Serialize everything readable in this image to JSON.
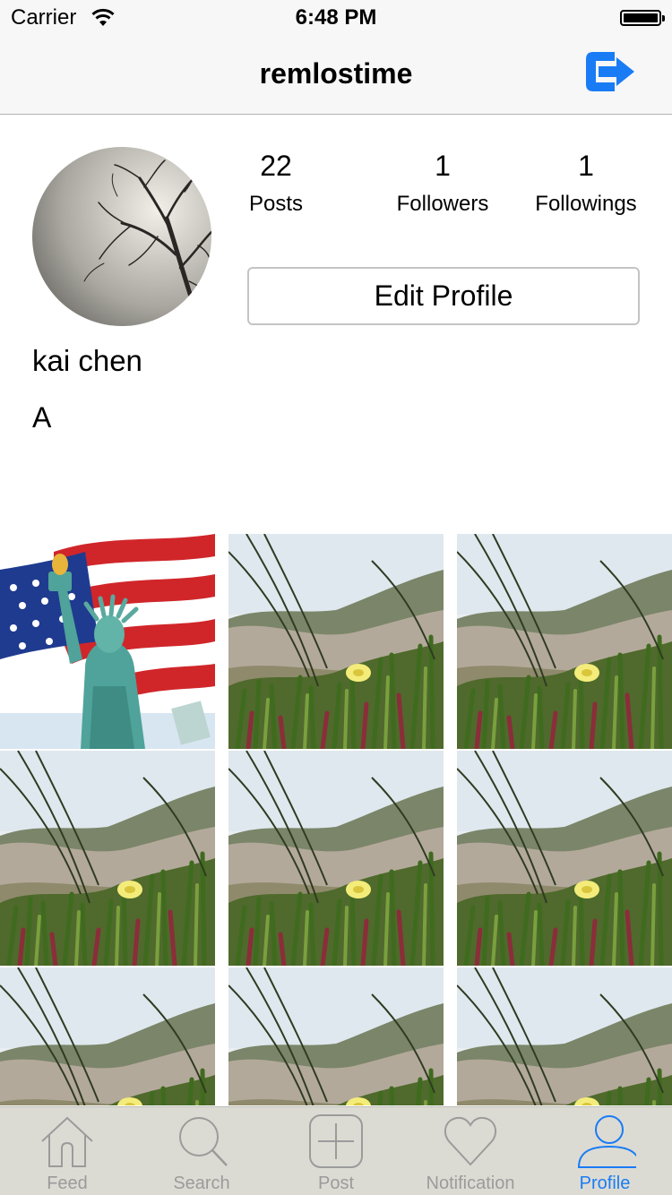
{
  "status_bar": {
    "carrier": "Carrier",
    "time": "6:48 PM"
  },
  "nav": {
    "title": "remlostime",
    "logout_icon": "logout-arrow-icon"
  },
  "profile": {
    "full_name": "kai chen",
    "bio": "A",
    "stats": [
      {
        "value": "22",
        "label": "Posts"
      },
      {
        "value": "1",
        "label": "Followers"
      },
      {
        "value": "1",
        "label": "Followings"
      }
    ],
    "edit_button": "Edit Profile"
  },
  "posts": [
    "statue-of-liberty-flag",
    "flower-dune",
    "flower-dune",
    "flower-dune",
    "flower-dune",
    "flower-dune",
    "flower-dune",
    "flower-dune",
    "flower-dune"
  ],
  "tabs": [
    {
      "label": "Feed",
      "icon": "home-icon",
      "active": false
    },
    {
      "label": "Search",
      "icon": "search-icon",
      "active": false
    },
    {
      "label": "Post",
      "icon": "plus-square-icon",
      "active": false
    },
    {
      "label": "Notification",
      "icon": "heart-icon",
      "active": false
    },
    {
      "label": "Profile",
      "icon": "person-icon",
      "active": true
    }
  ],
  "colors": {
    "accent": "#1a7cf5",
    "tab_bar": "#dcdbd3",
    "nav_bar": "#f7f7f7",
    "inactive": "#9b9b9b"
  }
}
